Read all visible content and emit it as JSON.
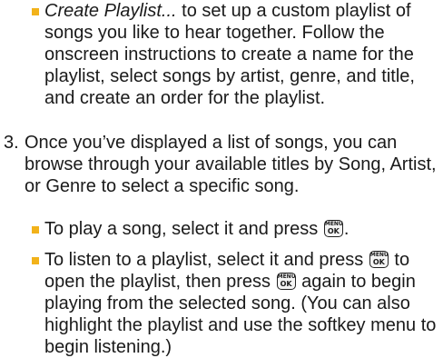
{
  "items": {
    "create_playlist": {
      "term": "Create Playlist...",
      "rest": " to set up a custom playlist of songs you like to hear together. Follow the onscreen instructions to create a name for the playlist, select songs by artist, genre, and title, and create an order for the playlist."
    },
    "step3": {
      "number": "3.",
      "text": "Once you’ve displayed a list of songs, you can browse through your available titles by Song, Artist, or Genre to select a specific song."
    },
    "play_song": {
      "text_before": "To play a song, select it and press",
      "text_after": "."
    },
    "listen_playlist": {
      "text_a": "To listen to a playlist, select it and press",
      "text_b": "to open the playlist, then press",
      "text_c": "again to begin playing from the selected song. (You can also highlight the playlist and use the softkey menu to begin listening.)"
    }
  },
  "key": {
    "top": "MENU",
    "bottom": "OK"
  },
  "accent_color": "#f2b21a"
}
